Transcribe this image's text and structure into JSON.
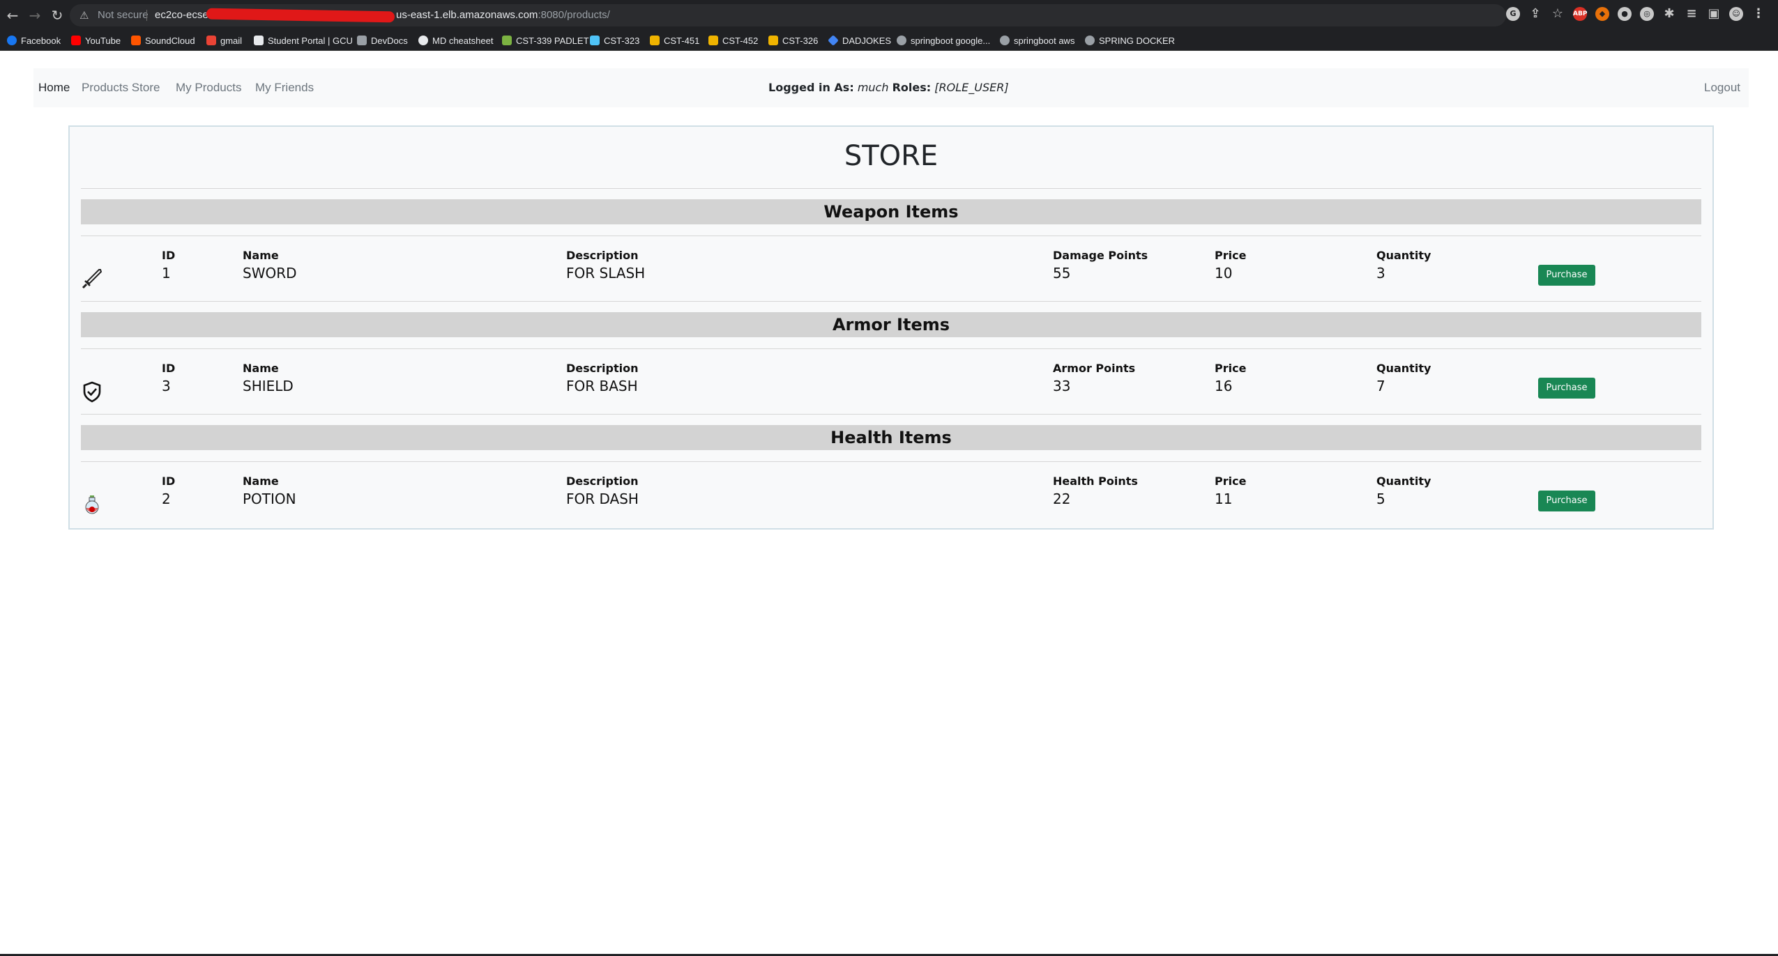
{
  "browser": {
    "security_label": "Not secure",
    "url_host_start": "ec2co-ecsel",
    "url_host_end": "us-east-1.elb.amazonaws.com",
    "url_path": ":8080/products/",
    "bookmarks": [
      {
        "label": "Facebook",
        "icon": "facebook-icon",
        "color": "#1877f2"
      },
      {
        "label": "YouTube",
        "icon": "youtube-icon",
        "color": "#ff0000"
      },
      {
        "label": "SoundCloud",
        "icon": "soundcloud-icon",
        "color": "#ff5500"
      },
      {
        "label": "gmail",
        "icon": "gmail-icon",
        "color": "#ea4335"
      },
      {
        "label": "Student Portal | GCU",
        "icon": "document-icon",
        "color": "#e8eaed"
      },
      {
        "label": "DevDocs",
        "icon": "search-icon",
        "color": "#e8eaed"
      },
      {
        "label": "MD cheatsheet",
        "icon": "github-icon",
        "color": "#e8eaed"
      },
      {
        "label": "CST-339 PADLET",
        "icon": "padlet-icon",
        "color": "#7cb342"
      },
      {
        "label": "CST-323",
        "icon": "grid-icon",
        "color": "#4fc3f7"
      },
      {
        "label": "CST-451",
        "icon": "gcu-icon",
        "color": "#f0b400"
      },
      {
        "label": "CST-452",
        "icon": "gcu-icon",
        "color": "#f0b400"
      },
      {
        "label": "CST-326",
        "icon": "gcu-icon",
        "color": "#f0b400"
      },
      {
        "label": "DADJOKES",
        "icon": "diamond-icon",
        "color": "#4285f4"
      },
      {
        "label": "springboot google...",
        "icon": "globe-icon",
        "color": "#e8eaed"
      },
      {
        "label": "springboot aws",
        "icon": "globe-icon",
        "color": "#e8eaed"
      },
      {
        "label": "SPRING DOCKER",
        "icon": "globe-icon",
        "color": "#e8eaed"
      }
    ]
  },
  "navbar": {
    "links": [
      "Home",
      "Products Store",
      "My Products",
      "My Friends"
    ],
    "logged_in_label": "Logged in As:",
    "username": "much",
    "roles_label": "Roles:",
    "roles_value": "[ROLE_USER]",
    "logout": "Logout"
  },
  "store": {
    "title": "STORE",
    "sections": [
      {
        "title": "Weapon Items",
        "icon": "sword-icon",
        "headers": {
          "id": "ID",
          "name": "Name",
          "description": "Description",
          "points": "Damage Points",
          "price": "Price",
          "quantity": "Quantity"
        },
        "item": {
          "id": "1",
          "name": "SWORD",
          "description": "FOR SLASH",
          "points": "55",
          "price": "10",
          "quantity": "3"
        },
        "button": "Purchase"
      },
      {
        "title": "Armor Items",
        "icon": "shield-icon",
        "headers": {
          "id": "ID",
          "name": "Name",
          "description": "Description",
          "points": "Armor Points",
          "price": "Price",
          "quantity": "Quantity"
        },
        "item": {
          "id": "3",
          "name": "SHIELD",
          "description": "FOR BASH",
          "points": "33",
          "price": "16",
          "quantity": "7"
        },
        "button": "Purchase"
      },
      {
        "title": "Health Items",
        "icon": "potion-icon",
        "headers": {
          "id": "ID",
          "name": "Name",
          "description": "Description",
          "points": "Health Points",
          "price": "Price",
          "quantity": "Quantity"
        },
        "item": {
          "id": "2",
          "name": "POTION",
          "description": "FOR DASH",
          "points": "22",
          "price": "11",
          "quantity": "5"
        },
        "button": "Purchase"
      }
    ]
  },
  "colors": {
    "purchase_button": "#198754",
    "section_bar": "#d3d3d3",
    "navbar_bg": "#f8f9fa",
    "chrome_bg": "#202124"
  }
}
